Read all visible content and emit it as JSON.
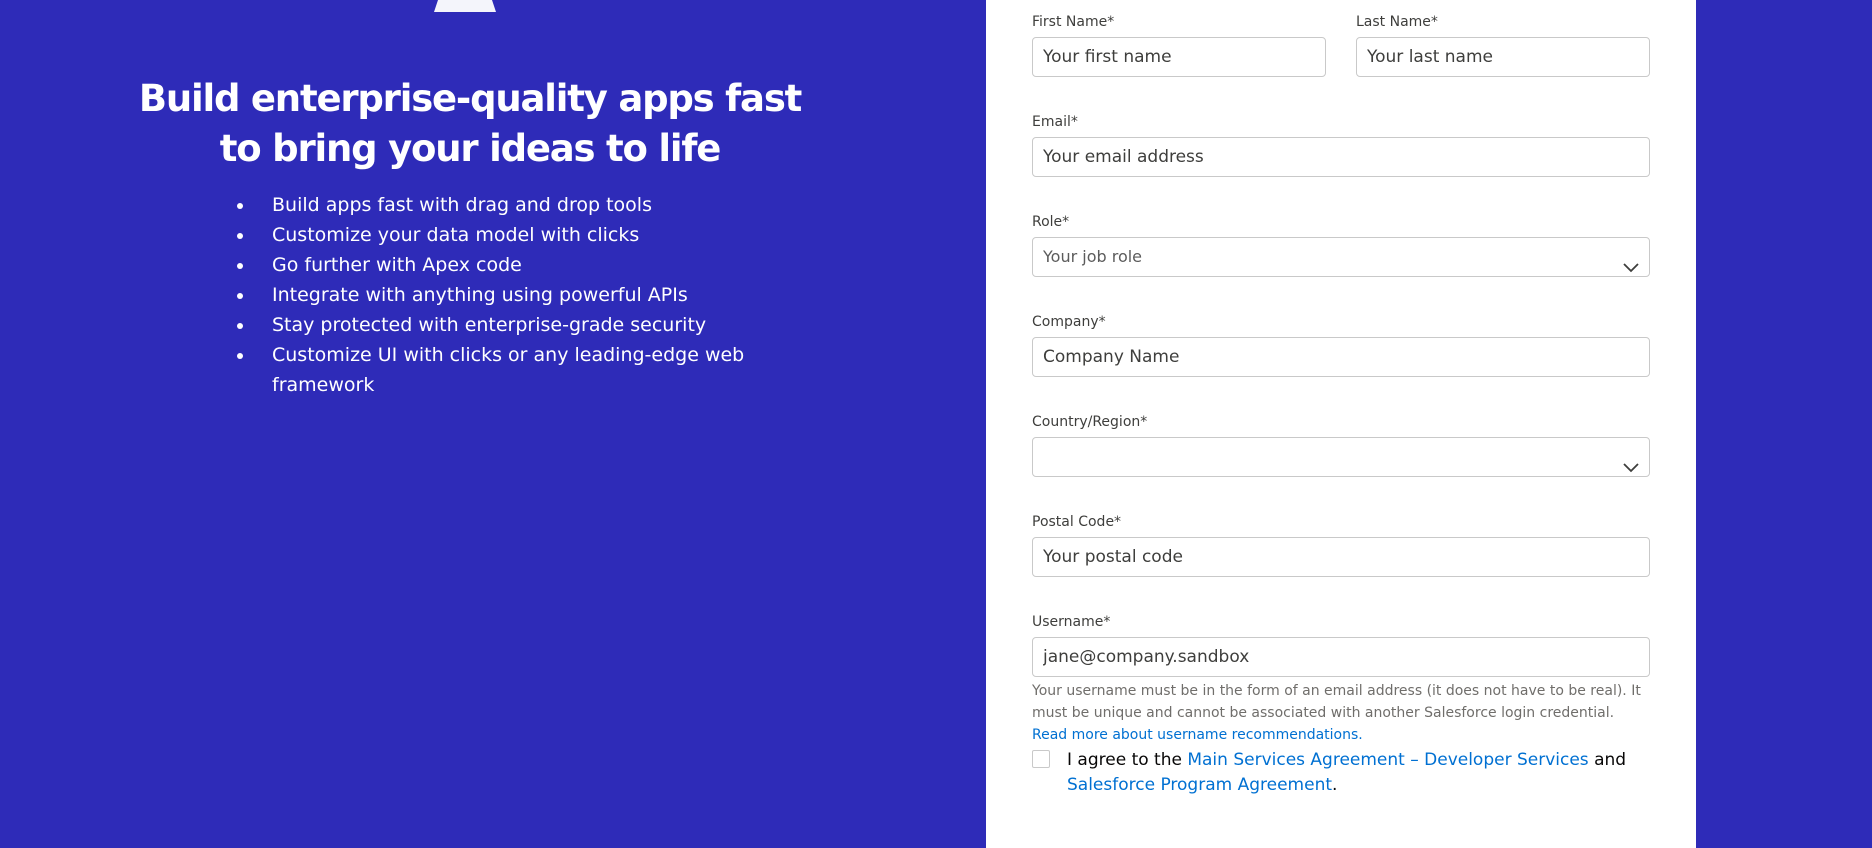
{
  "hero": {
    "title_line1": "Build enterprise-quality apps fast",
    "title_line2": "to bring your ideas to life",
    "features": [
      "Build apps fast with drag and drop tools",
      "Customize your data model with clicks",
      "Go further with Apex code",
      "Integrate with anything using powerful APIs",
      "Stay protected with enterprise-grade security",
      "Customize UI with clicks or any leading-edge web framework"
    ]
  },
  "form": {
    "first_name": {
      "label": "First Name*",
      "placeholder": "Your first name"
    },
    "last_name": {
      "label": "Last Name*",
      "placeholder": "Your last name"
    },
    "email": {
      "label": "Email*",
      "placeholder": "Your email address"
    },
    "role": {
      "label": "Role*",
      "selected": "Your job role"
    },
    "company": {
      "label": "Company*",
      "placeholder": "Company Name"
    },
    "country": {
      "label": "Country/Region*",
      "selected": ""
    },
    "postal_code": {
      "label": "Postal Code*",
      "placeholder": "Your postal code"
    },
    "username": {
      "label": "Username*",
      "value": "jane@company.sandbox"
    },
    "username_help": {
      "text": "Your username must be in the form of an email address (it does not have to be real). It must be unique and cannot be associated with another Salesforce login credential. ",
      "link": "Read more about username recommendations."
    },
    "agreement": {
      "prefix": "I agree to the ",
      "link1": "Main Services Agreement – Developer Services",
      "middle": " and ",
      "link2": "Salesforce Program Agreement",
      "suffix": "."
    }
  },
  "icons": {
    "chevron": "chevron-down-icon",
    "logo": "logo-mark-icon"
  },
  "colors": {
    "background": "#2e2bb8",
    "card": "#ffffff",
    "link": "#0070d2",
    "input_border": "#c9c9c9"
  }
}
